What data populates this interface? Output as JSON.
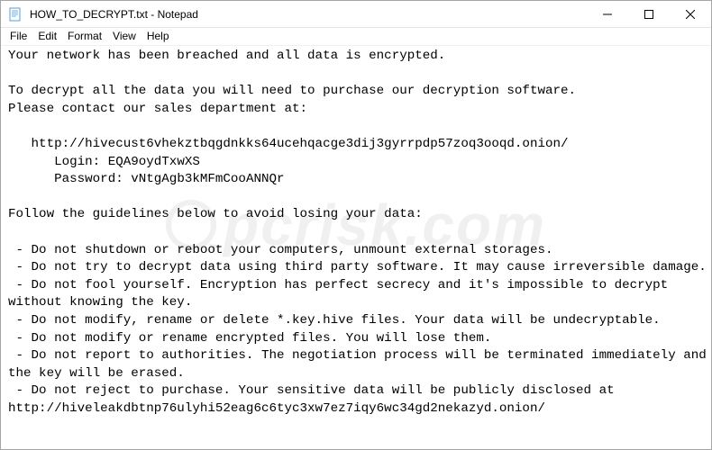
{
  "titlebar": {
    "title": "HOW_TO_DECRYPT.txt - Notepad"
  },
  "menubar": {
    "items": [
      "File",
      "Edit",
      "Format",
      "View",
      "Help"
    ]
  },
  "document": {
    "text": "Your network has been breached and all data is encrypted.\n\nTo decrypt all the data you will need to purchase our decryption software.\nPlease contact our sales department at:\n\n   http://hivecust6vhekztbqgdnkks64ucehqacge3dij3gyrrpdp57zoq3ooqd.onion/\n      Login: EQA9oydTxwXS\n      Password: vNtgAgb3kMFmCooANNQr\n\nFollow the guidelines below to avoid losing your data:\n\n - Do not shutdown or reboot your computers, unmount external storages.\n - Do not try to decrypt data using third party software. It may cause irreversible damage.\n - Do not fool yourself. Encryption has perfect secrecy and it's impossible to decrypt without knowing the key.\n - Do not modify, rename or delete *.key.hive files. Your data will be undecryptable.\n - Do not modify or rename encrypted files. You will lose them.\n - Do not report to authorities. The negotiation process will be terminated immediately and the key will be erased.\n - Do not reject to purchase. Your sensitive data will be publicly disclosed at http://hiveleakdbtnp76ulyhi52eag6c6tyc3xw7ez7iqy6wc34gd2nekazyd.onion/"
  },
  "watermark": {
    "text": "pcrisk.com"
  }
}
